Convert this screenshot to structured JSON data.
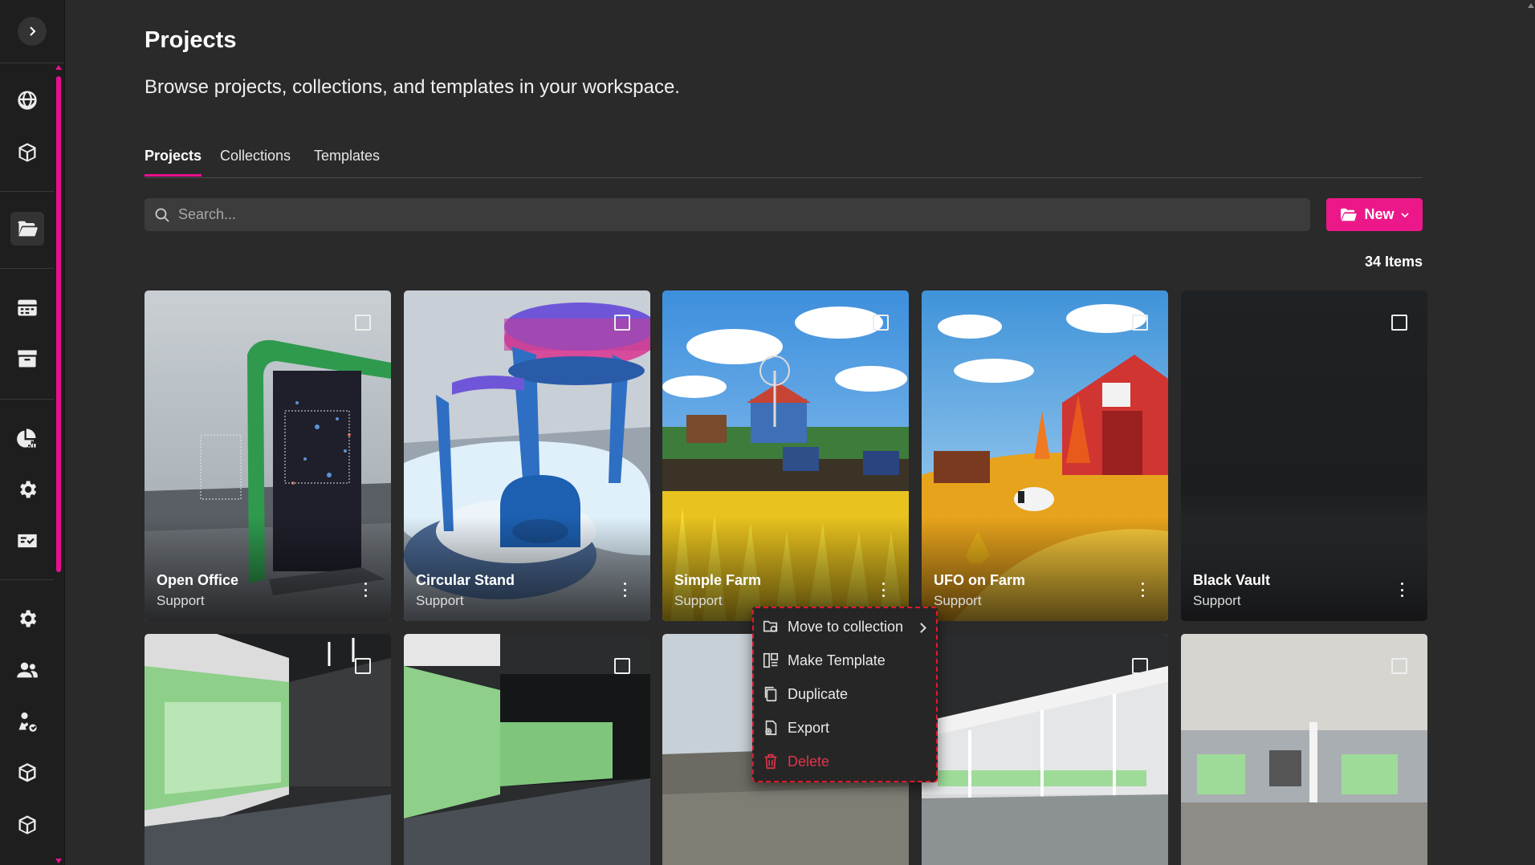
{
  "page": {
    "title": "Projects",
    "subtitle": "Browse projects, collections, and templates in your workspace."
  },
  "tabs": [
    {
      "label": "Projects",
      "active": true
    },
    {
      "label": "Collections",
      "active": false
    },
    {
      "label": "Templates",
      "active": false
    }
  ],
  "search": {
    "placeholder": "Search..."
  },
  "new_button": {
    "label": "New"
  },
  "item_count": "34 Items",
  "accent_color": "#ec1889",
  "sidebar": {
    "icons": [
      "globe-icon",
      "cube-icon",
      "folder-open-icon",
      "calendar-icon",
      "archive-icon",
      "analytics-icon",
      "settings-icon",
      "id-card-icon",
      "gear-icon",
      "users-icon",
      "user-check-icon",
      "boxes-icon",
      "package-icon"
    ]
  },
  "projects": [
    {
      "name": "Open Office",
      "owner": "Support"
    },
    {
      "name": "Circular Stand",
      "owner": "Support"
    },
    {
      "name": "Simple Farm",
      "owner": "Support"
    },
    {
      "name": "UFO on Farm",
      "owner": "Support"
    },
    {
      "name": "Black Vault",
      "owner": "Support"
    }
  ],
  "context_menu": {
    "items": [
      {
        "label": "Move to collection",
        "icon": "folder-move-icon",
        "has_submenu": true
      },
      {
        "label": "Make Template",
        "icon": "template-icon"
      },
      {
        "label": "Duplicate",
        "icon": "duplicate-icon"
      },
      {
        "label": "Export",
        "icon": "export-icon"
      },
      {
        "label": "Delete",
        "icon": "trash-icon",
        "danger": true
      }
    ]
  }
}
